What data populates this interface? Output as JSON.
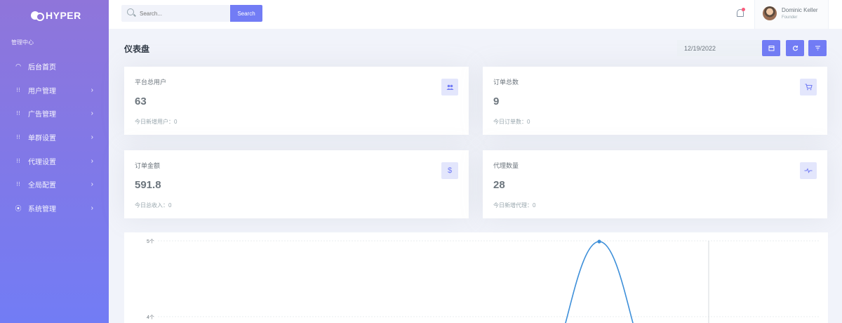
{
  "brand": {
    "name": "HYPER"
  },
  "sidebar": {
    "section_title": "管理中心",
    "items": [
      {
        "label": "后台首页",
        "icon": "dashboard-icon",
        "has_arrow": false
      },
      {
        "label": "用户管理",
        "icon": "grid-icon",
        "has_arrow": true
      },
      {
        "label": "广告管理",
        "icon": "grid-icon",
        "has_arrow": true
      },
      {
        "label": "单群设置",
        "icon": "grid-icon",
        "has_arrow": true
      },
      {
        "label": "代理设置",
        "icon": "grid-icon",
        "has_arrow": true
      },
      {
        "label": "全局配置",
        "icon": "grid-icon",
        "has_arrow": true
      },
      {
        "label": "系统管理",
        "icon": "location-pin-icon",
        "has_arrow": true
      }
    ]
  },
  "topbar": {
    "search": {
      "placeholder": "Search...",
      "button_label": "Search"
    },
    "user": {
      "name": "Dominic Keller",
      "role": "Founder"
    }
  },
  "page": {
    "title": "仪表盘",
    "date_value": "12/19/2022"
  },
  "stats": [
    {
      "title": "平台总用户",
      "value": "63",
      "sub": "今日新增用户：0",
      "icon": "users-icon",
      "glyph": "👥"
    },
    {
      "title": "订单总数",
      "value": "9",
      "sub": "今日订单数：0",
      "icon": "cart-icon",
      "glyph": "🛒"
    },
    {
      "title": "订单金额",
      "value": "591.8",
      "sub": "今日总收入：0",
      "icon": "dollar-icon",
      "glyph": "$"
    },
    {
      "title": "代理数量",
      "value": "28",
      "sub": "今日新增代理：0",
      "icon": "pulse-icon",
      "glyph": "∿"
    }
  ],
  "chart_data": {
    "type": "line",
    "y_tick_labels": [
      "5个",
      "4个"
    ],
    "visible_ymax": 5,
    "visible_ymin": 4,
    "series": [
      {
        "color": "#3d8fd9",
        "peak_value": 5
      }
    ]
  }
}
